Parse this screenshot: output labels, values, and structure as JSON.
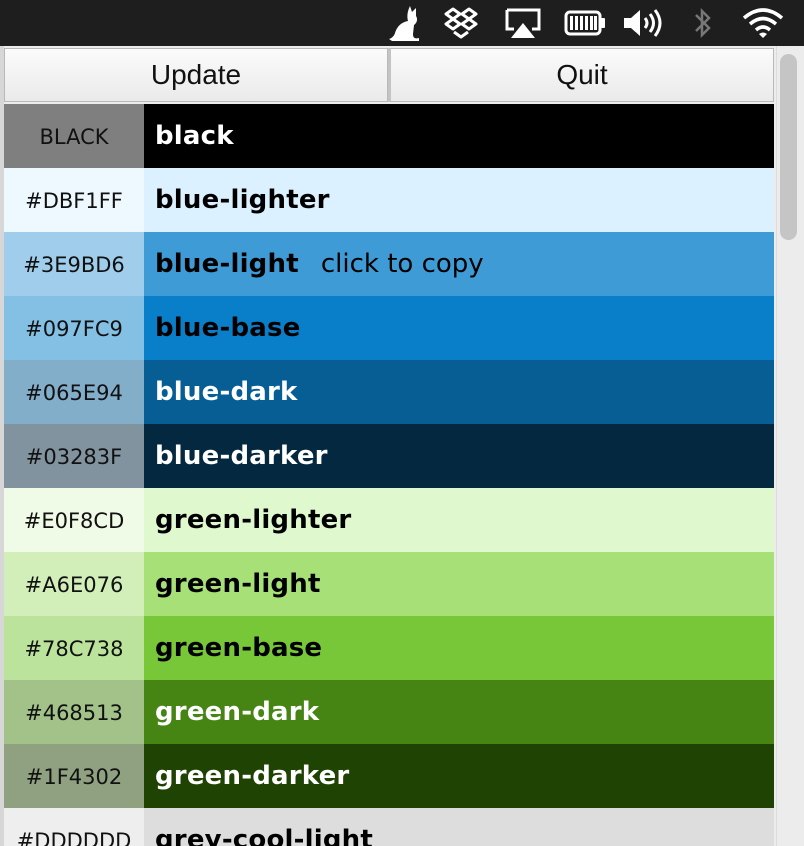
{
  "menubar": {
    "icons": [
      "cat-icon",
      "dropbox-icon",
      "airplay-icon",
      "battery-icon",
      "volume-icon",
      "bluetooth-icon",
      "wifi-icon"
    ]
  },
  "buttons": {
    "update_label": "Update",
    "quit_label": "Quit"
  },
  "colors": [
    {
      "hex": "BLACK",
      "name": "black",
      "swatch": "#000000",
      "hex_bg": "#7f7f7f",
      "text": "#ffffff",
      "hint": ""
    },
    {
      "hex": "#DBF1FF",
      "name": "blue-lighter",
      "swatch": "#DBF1FF",
      "hex_bg": "#edf8ff",
      "text": "#000000",
      "hint": ""
    },
    {
      "hex": "#3E9BD6",
      "name": "blue-light",
      "swatch": "#3E9BD6",
      "hex_bg": "#9fcdeb",
      "text": "#000000",
      "hint": "click to copy"
    },
    {
      "hex": "#097FC9",
      "name": "blue-base",
      "swatch": "#097FC9",
      "hex_bg": "#84bfe4",
      "text": "#000000",
      "hint": ""
    },
    {
      "hex": "#065E94",
      "name": "blue-dark",
      "swatch": "#065E94",
      "hex_bg": "#82aeca",
      "text": "#ffffff",
      "hint": ""
    },
    {
      "hex": "#03283F",
      "name": "blue-darker",
      "swatch": "#03283F",
      "hex_bg": "#81939f",
      "text": "#ffffff",
      "hint": ""
    },
    {
      "hex": "#E0F8CD",
      "name": "green-lighter",
      "swatch": "#E0F8CD",
      "hex_bg": "#effbe6",
      "text": "#000000",
      "hint": ""
    },
    {
      "hex": "#A6E076",
      "name": "green-light",
      "swatch": "#A6E076",
      "hex_bg": "#d2efba",
      "text": "#000000",
      "hint": ""
    },
    {
      "hex": "#78C738",
      "name": "green-base",
      "swatch": "#78C738",
      "hex_bg": "#bbe39b",
      "text": "#000000",
      "hint": ""
    },
    {
      "hex": "#468513",
      "name": "green-dark",
      "swatch": "#468513",
      "hex_bg": "#a2c289",
      "text": "#ffffff",
      "hint": ""
    },
    {
      "hex": "#1F4302",
      "name": "green-darker",
      "swatch": "#1F4302",
      "hex_bg": "#8fa180",
      "text": "#ffffff",
      "hint": ""
    },
    {
      "hex": "#DDDDDD",
      "name": "grey-cool-light",
      "swatch": "#DDDDDD",
      "hex_bg": "#eeeeee",
      "text": "#000000",
      "hint": ""
    }
  ]
}
